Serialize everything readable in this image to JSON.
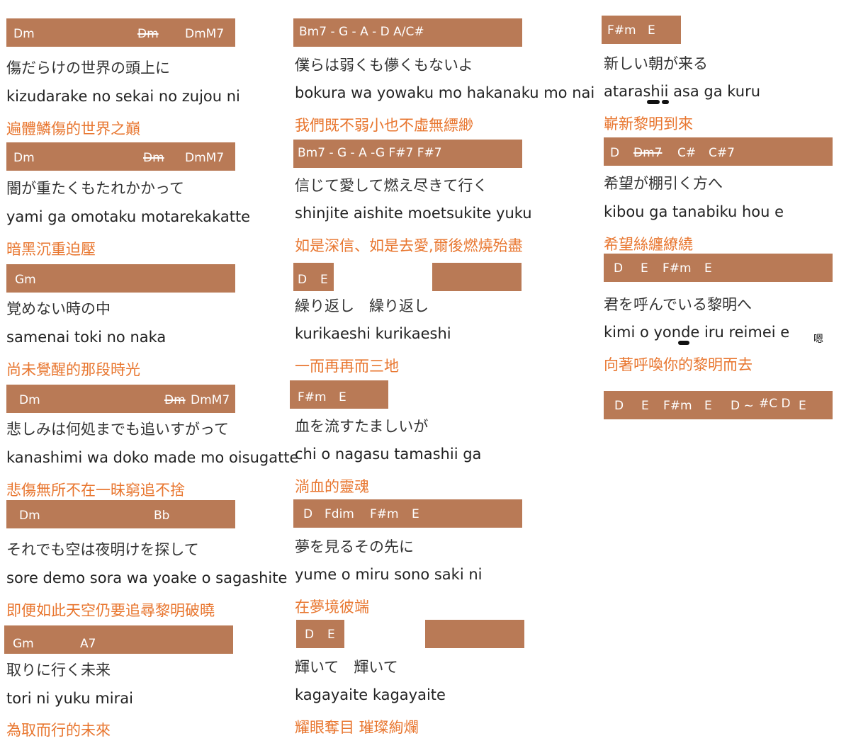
{
  "col1": {
    "chords": [
      [
        "Dm",
        "Dm",
        "DmM7"
      ],
      [
        "Dm",
        "Dm",
        "DmM7"
      ],
      [
        "Gm"
      ],
      [
        "Dm",
        "Dm",
        "DmM7"
      ],
      [
        "Dm",
        "Bb"
      ],
      [
        "Gm",
        "A7"
      ]
    ],
    "lines": [
      [
        "傷だらけの世界の頭上に",
        "kizudarake no sekai no zujou ni",
        "遍體鱗傷的世界之巔"
      ],
      [
        "闇が重たくもたれかかって",
        "yami ga omotaku motarekakatte",
        "暗黑沉重迫壓"
      ],
      [
        "覚めない時の中",
        "samenai toki no naka",
        "尚未覺醒的那段時光"
      ],
      [
        "悲しみは何処までも追いすがって",
        "kanashimi wa doko made mo oisugatte",
        "悲傷無所不在一昧窮追不捨"
      ],
      [
        "それでも空は夜明けを探して",
        "sore demo sora wa yoake  o sagashite",
        "即便如此天空仍要追尋黎明破曉"
      ],
      [
        "取りに行く未来",
        "tori ni yuku mirai",
        "為取而行的未來"
      ]
    ]
  },
  "col2": {
    "chords": [
      [
        "Bm7 - G - A - D A/C#"
      ],
      [
        "Bm7 - G - A -G F#7 F#7"
      ],
      [
        "D",
        "E"
      ],
      [
        "F#m",
        "E"
      ],
      [
        "D",
        "Fdim",
        "F#m",
        "E"
      ],
      [
        "D",
        "E"
      ]
    ],
    "lines": [
      [
        "僕らは弱くも儚くもないよ",
        "bokura wa yowaku mo hakanaku mo nai yo",
        "我們既不弱小也不虛無縹緲"
      ],
      [
        "信じて愛して燃え尽きて行く",
        "shinjite aishite moetsukite yuku",
        "如是深信、如是去愛,爾後燃燒殆盡"
      ],
      [
        "繰り返し　繰り返し",
        "kurikaeshi kurikaeshi",
        "一而再再而三地"
      ],
      [
        "血を流すたましいが",
        "chi   o nagasu tamashii ga",
        "淌血的靈魂"
      ],
      [
        "夢を見るその先に",
        "yume    o miru sono saki ni",
        "在夢境彼端"
      ],
      [
        "輝いて　輝いて",
        "kagayaite kagayaite",
        "耀眼奪目 璀璨絢爛"
      ]
    ]
  },
  "col3": {
    "chords": [
      [
        "F#m",
        "E"
      ],
      [
        "D",
        "Dm7",
        "C#",
        "C#7"
      ],
      [
        "D",
        "E",
        "F#m",
        "E"
      ],
      [
        "D",
        "E",
        "F#m",
        "E",
        "D ~",
        "#C D",
        "E"
      ]
    ],
    "lines": [
      [
        "新しい朝が来る",
        "atarashii asa ga kuru",
        "嶄新黎明到來"
      ],
      [
        "希望が棚引く方へ",
        "kibou ga tanabiku hou e",
        "希望絲纏繚繞"
      ],
      [
        "君を呼んでいる黎明へ",
        "kimi    o yonde iru reimei e",
        "向著呼喚你的黎明而去"
      ]
    ],
    "note": "嗯"
  }
}
